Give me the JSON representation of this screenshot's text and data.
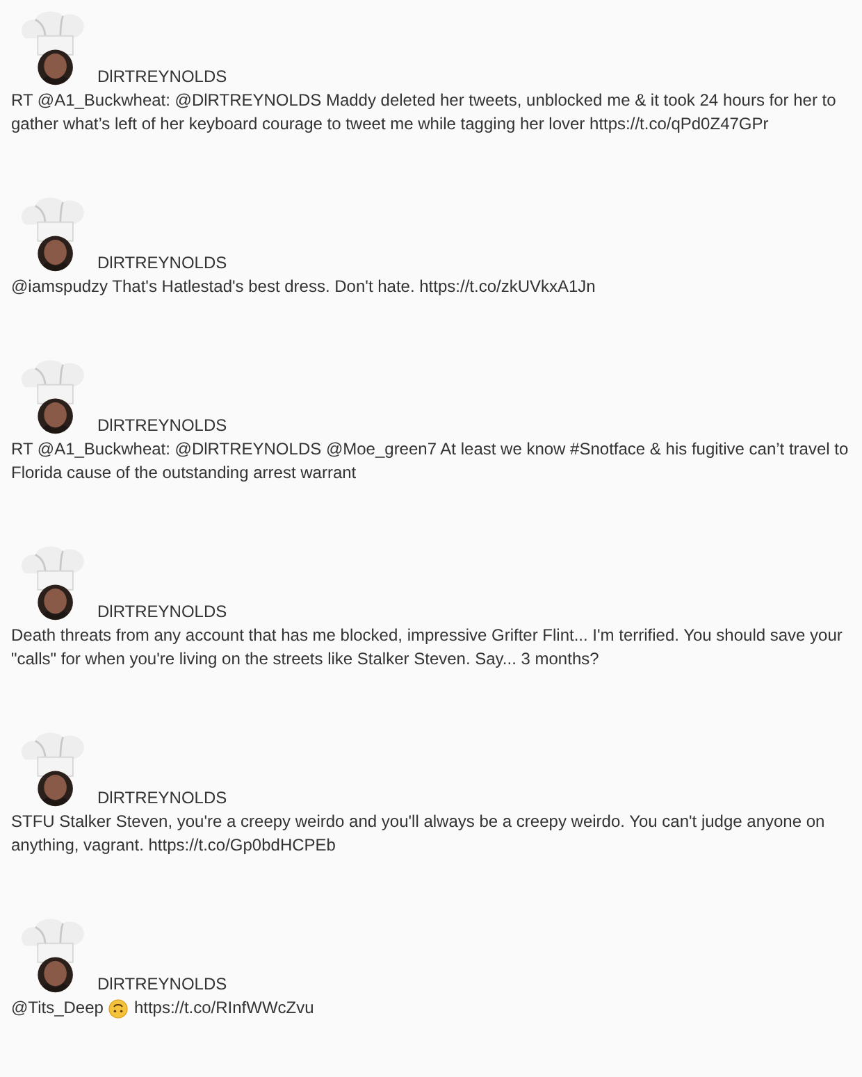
{
  "tweets": [
    {
      "author": "DlRTREYNOLDS",
      "segments": [
        {
          "kind": "text",
          "text": "RT @A1_Buckwheat: @DlRTREYNOLDS Maddy deleted her tweets, unblocked me & it took 24 hours for her to gather what’s left of her keyboard courage to tweet me while tagging her lover https://t.co/qPd0Z47GPr"
        }
      ]
    },
    {
      "author": "DlRTREYNOLDS",
      "segments": [
        {
          "kind": "text",
          "text": "@iamspudzy That's Hatlestad's best dress. Don't hate. https://t.co/zkUVkxA1Jn"
        }
      ]
    },
    {
      "author": "DlRTREYNOLDS",
      "segments": [
        {
          "kind": "text",
          "text": "RT @A1_Buckwheat: @DlRTREYNOLDS @Moe_green7 At least we know #Snotface & his fugitive can’t travel to Florida cause of the outstanding arrest warrant"
        }
      ]
    },
    {
      "author": "DlRTREYNOLDS",
      "segments": [
        {
          "kind": "text",
          "text": "Death threats from any account that has me blocked, impressive Grifter Flint... I'm terrified. You should save your \"calls\" for when you're living on the streets like Stalker Steven. Say... 3 months?"
        }
      ]
    },
    {
      "author": "DlRTREYNOLDS",
      "segments": [
        {
          "kind": "text",
          "text": "STFU Stalker Steven, you're a creepy weirdo and you'll always be a creepy weirdo. You can't judge anyone on anything, vagrant. https://t.co/Gp0bdHCPEb"
        }
      ]
    },
    {
      "author": "DlRTREYNOLDS",
      "segments": [
        {
          "kind": "text",
          "text": "@Tits_Deep"
        },
        {
          "kind": "emoji"
        },
        {
          "kind": "text",
          "text": "https://t.co/RInfWWcZvu"
        }
      ]
    }
  ]
}
